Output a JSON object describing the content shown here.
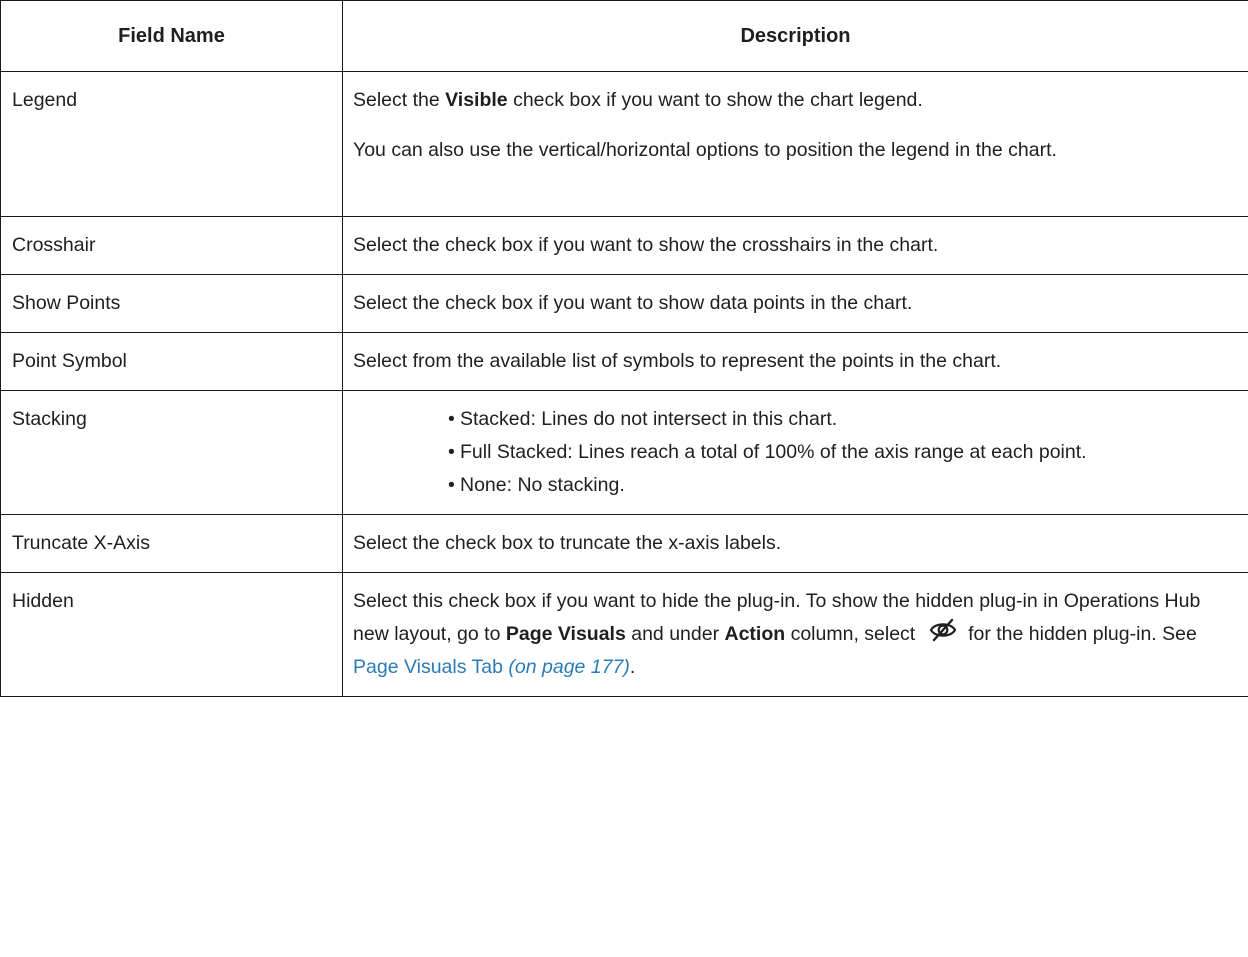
{
  "table": {
    "headers": {
      "field": "Field Name",
      "description": "Description"
    },
    "rows": {
      "legend": {
        "name": "Legend",
        "p1": {
          "pre": "Select the ",
          "bold": "Visible",
          "post": " check box if you want to show the chart legend."
        },
        "p2": "You can also use the vertical/horizontal options to position the legend in the chart."
      },
      "crosshair": {
        "name": "Crosshair",
        "desc": "Select the check box if you want to show the crosshairs in the chart."
      },
      "show_points": {
        "name": "Show Points",
        "desc": "Select the check box if you want to show data points in the chart."
      },
      "point_symbol": {
        "name": "Point Symbol",
        "desc": "Select from the available list of symbols to represent the points in the chart."
      },
      "stacking": {
        "name": "Stacking",
        "bullet_char": "•",
        "items": [
          "Stacked: Lines do not intersect in this chart.",
          "Full Stacked: Lines reach a total of 100% of the axis range at each point.",
          "None: No stacking."
        ]
      },
      "truncate": {
        "name": "Truncate X-Axis",
        "desc": "Select the check box to truncate the x-axis labels."
      },
      "hidden": {
        "name": "Hidden",
        "t1": "Select this check box if you want to hide the plug-in. To show the hidden plug-in in Operations Hub new layout, go to ",
        "b1": "Page Visuals",
        "t2": " and under ",
        "b2": "Action",
        "t3": " column, select ",
        "icon": "eye-slash-icon",
        "t4": " for the hidden plug-in. See ",
        "link_text": "Page Visuals Tab",
        "link_page": "(on page 177)",
        "t5": "."
      }
    }
  },
  "colors": {
    "text": "#1f1f1f",
    "border": "#1a1a1a",
    "link": "#2b7bb9"
  }
}
